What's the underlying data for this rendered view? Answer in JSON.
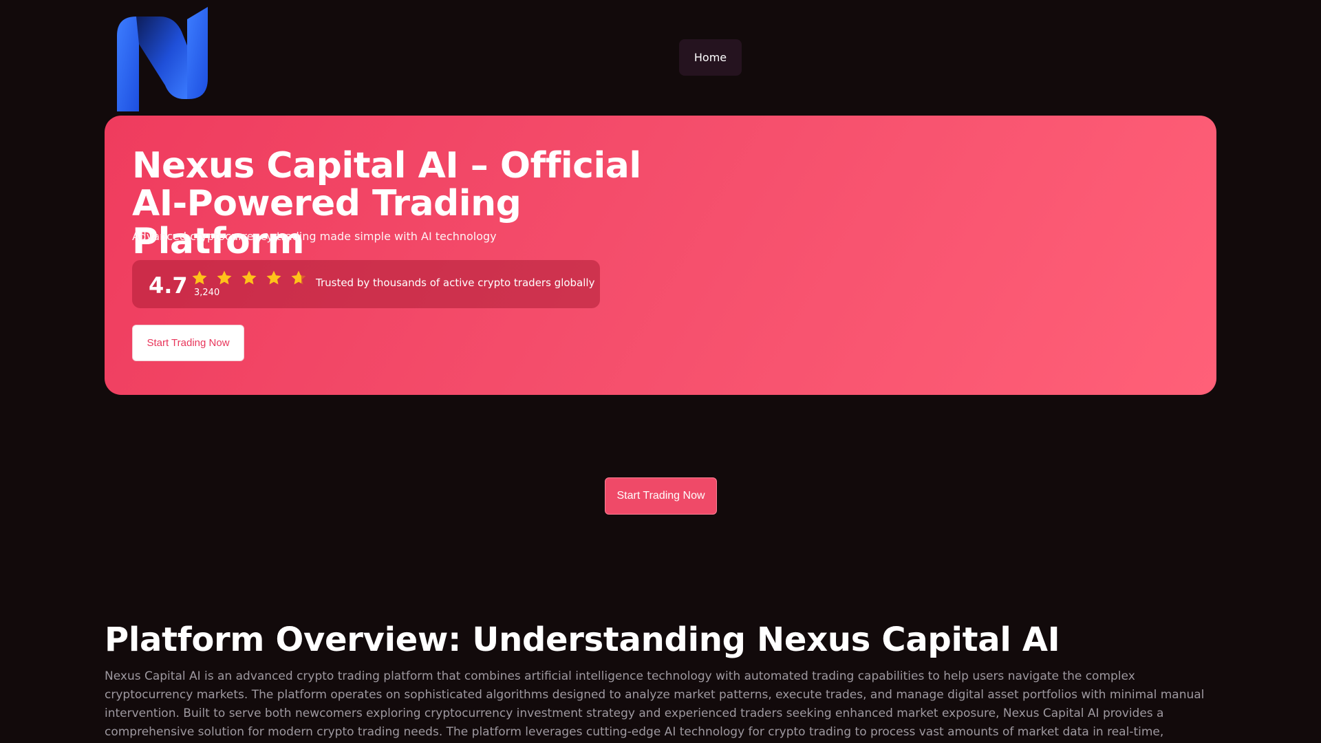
{
  "header": {
    "logo_icon": "n-logo-icon",
    "nav": [
      {
        "label": "Home"
      }
    ]
  },
  "hero": {
    "title": "Nexus Capital AI – Official AI-Powered Trading Platform",
    "subtitle": "Advanced cryptocurrency trading made simple with AI technology",
    "rating": {
      "score": "4.7",
      "count": "3,240",
      "stars": 4.7,
      "trust_text": "Trusted by thousands of active crypto traders globally"
    },
    "cta_label": "Start Trading Now",
    "colors": {
      "start": "#ef3c5e",
      "end": "#ff6078"
    }
  },
  "middle_cta": {
    "label": "Start Trading Now",
    "color": "#ef4a68"
  },
  "overview": {
    "title": "Platform Overview: Understanding Nexus Capital AI",
    "text": "Nexus Capital AI is an advanced crypto trading platform that combines artificial intelligence technology with automated trading capabilities to help users navigate the complex cryptocurrency markets. The platform operates on sophisticated algorithms designed to analyze market patterns, execute trades, and manage digital asset portfolios with minimal manual intervention. Built to serve both newcomers exploring cryptocurrency investment strategy and experienced traders seeking enhanced market exposure, Nexus Capital AI provides a comprehensive solution for modern crypto trading needs. The platform leverages cutting-edge AI technology for crypto trading to process vast amounts of market data in real-time, identifying potential opportunities across multiple digital assets. By"
  },
  "theme": {
    "background": "#120a0b",
    "star_color": "#ffc21a",
    "logo_blue": "#2f6bff"
  }
}
